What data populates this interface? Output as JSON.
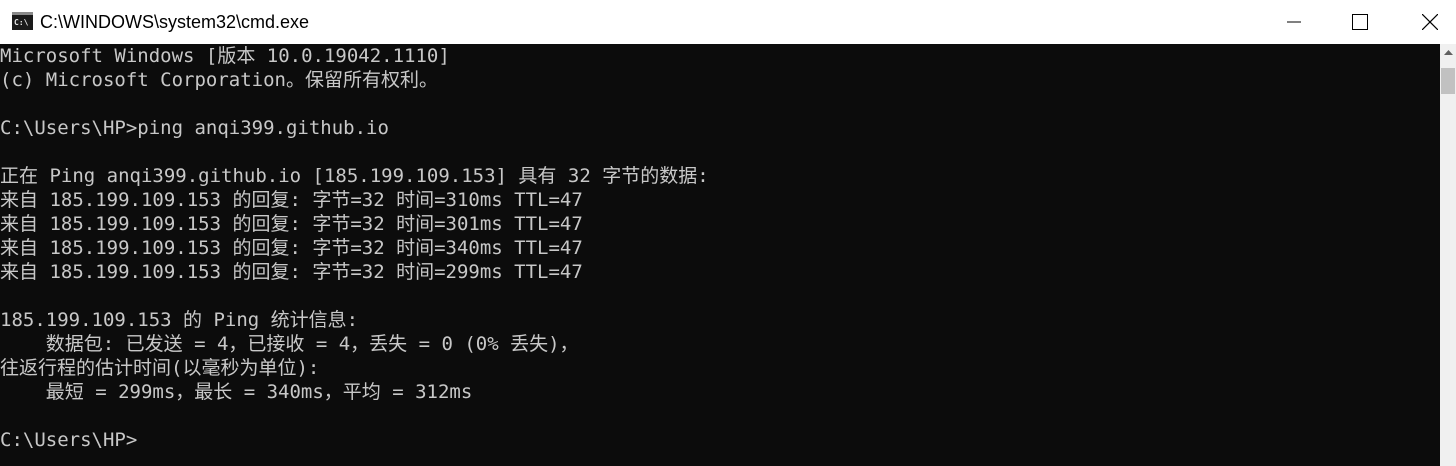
{
  "window": {
    "title": "C:\\WINDOWS\\system32\\cmd.exe",
    "icon_label": "C:\\",
    "icon": "cmd-icon",
    "controls": {
      "minimize": "minimize-icon",
      "maximize": "maximize-icon",
      "close": "close-icon"
    }
  },
  "console": {
    "lines": [
      "Microsoft Windows [版本 10.0.19042.1110]",
      "(c) Microsoft Corporation。保留所有权利。",
      "",
      "C:\\Users\\HP>ping anqi399.github.io",
      "",
      "正在 Ping anqi399.github.io [185.199.109.153] 具有 32 字节的数据:",
      "来自 185.199.109.153 的回复: 字节=32 时间=310ms TTL=47",
      "来自 185.199.109.153 的回复: 字节=32 时间=301ms TTL=47",
      "来自 185.199.109.153 的回复: 字节=32 时间=340ms TTL=47",
      "来自 185.199.109.153 的回复: 字节=32 时间=299ms TTL=47",
      "",
      "185.199.109.153 的 Ping 统计信息:",
      "    数据包: 已发送 = 4，已接收 = 4，丢失 = 0 (0% 丢失)，",
      "往返行程的估计时间(以毫秒为单位):",
      "    最短 = 299ms，最长 = 340ms，平均 = 312ms",
      "",
      "C:\\Users\\HP>"
    ]
  },
  "colors": {
    "console_bg": "#0c0c0c",
    "console_text": "#c8c8c8",
    "titlebar_bg": "#ffffff"
  }
}
